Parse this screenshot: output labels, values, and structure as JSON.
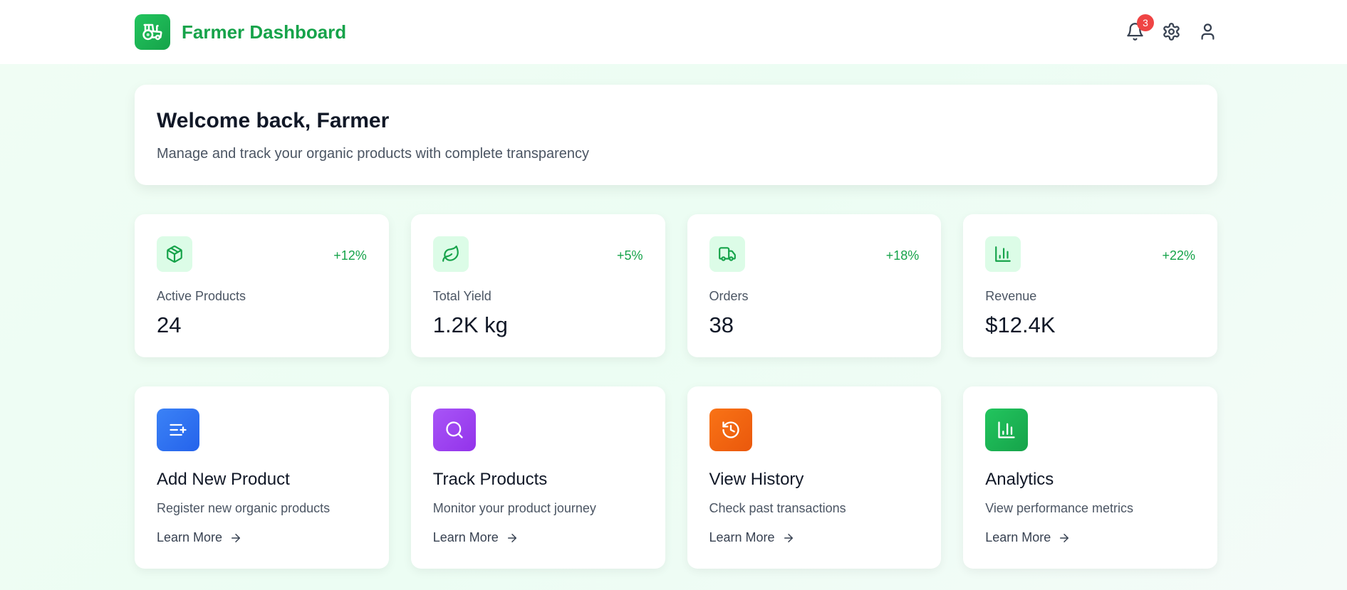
{
  "header": {
    "title": "Farmer Dashboard",
    "logo_icon": "tractor-icon",
    "notification_count": "3",
    "icons": [
      "bell-icon",
      "gear-icon",
      "user-icon"
    ]
  },
  "welcome": {
    "heading": "Welcome back, Farmer",
    "subtitle": "Manage and track your organic products with complete transparency"
  },
  "stats": [
    {
      "icon": "package-icon",
      "delta": "+12%",
      "label": "Active Products",
      "value": "24"
    },
    {
      "icon": "leaf-icon",
      "delta": "+5%",
      "label": "Total Yield",
      "value": "1.2K kg"
    },
    {
      "icon": "truck-icon",
      "delta": "+18%",
      "label": "Orders",
      "value": "38"
    },
    {
      "icon": "bar-chart-icon",
      "delta": "+22%",
      "label": "Revenue",
      "value": "$12.4K"
    }
  ],
  "actions": [
    {
      "icon": "list-plus-icon",
      "color": "#3b82f6",
      "title": "Add New Product",
      "description": "Register new organic products",
      "link": "Learn More"
    },
    {
      "icon": "search-icon",
      "color": "#a855f7",
      "title": "Track Products",
      "description": "Monitor your product journey",
      "link": "Learn More"
    },
    {
      "icon": "history-icon",
      "color": "#f97316",
      "title": "View History",
      "description": "Check past transactions",
      "link": "Learn More"
    },
    {
      "icon": "bar-chart-icon",
      "color": "#22c55e",
      "title": "Analytics",
      "description": "View performance metrics",
      "link": "Learn More"
    }
  ],
  "colors": {
    "accent": "#16a34a",
    "accent_light": "#dcfce7",
    "badge": "#ef4444"
  }
}
